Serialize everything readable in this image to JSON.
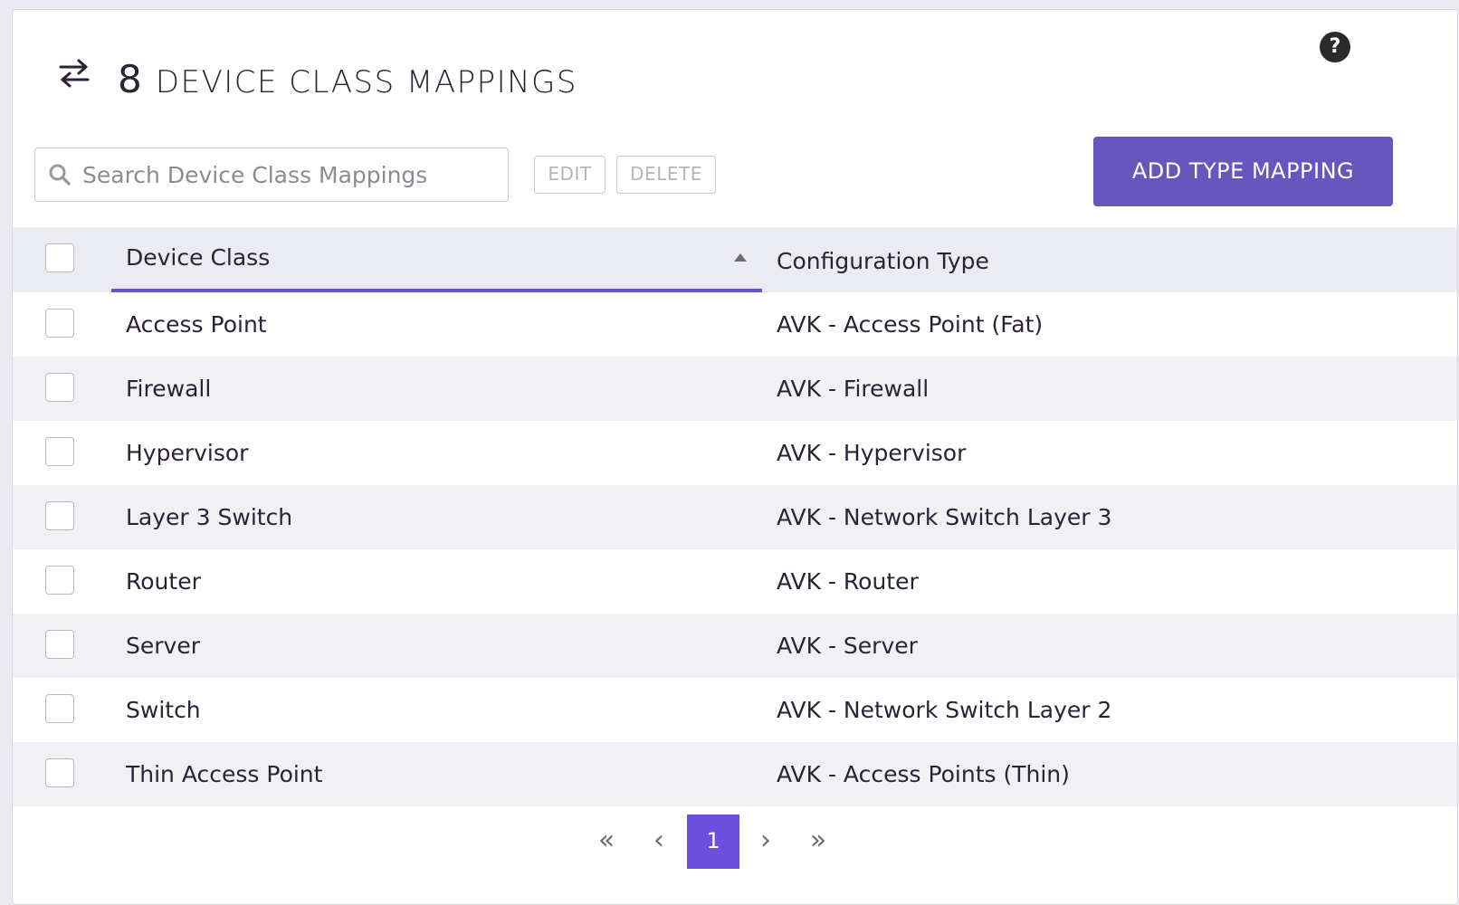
{
  "header": {
    "count": "8",
    "title": "DEVICE CLASS MAPPINGS",
    "title_icon": "swap-arrows-icon",
    "help_icon": "help-icon",
    "help_glyph": "?"
  },
  "toolbar": {
    "search_placeholder": "Search Device Class Mappings",
    "search_value": "",
    "edit_label": "EDIT",
    "delete_label": "DELETE",
    "add_label": "ADD TYPE MAPPING"
  },
  "table": {
    "columns": [
      "Device Class",
      "Configuration Type"
    ],
    "sort_column": "Device Class",
    "sort_direction": "ascending",
    "rows": [
      {
        "device_class": "Access Point",
        "configuration_type": "AVK - Access Point (Fat)"
      },
      {
        "device_class": "Firewall",
        "configuration_type": "AVK - Firewall"
      },
      {
        "device_class": "Hypervisor",
        "configuration_type": "AVK - Hypervisor"
      },
      {
        "device_class": "Layer 3 Switch",
        "configuration_type": "AVK - Network Switch Layer 3"
      },
      {
        "device_class": "Router",
        "configuration_type": "AVK - Router"
      },
      {
        "device_class": "Server",
        "configuration_type": "AVK - Server"
      },
      {
        "device_class": "Switch",
        "configuration_type": "AVK - Network Switch Layer 2"
      },
      {
        "device_class": "Thin Access Point",
        "configuration_type": "AVK - Access Points (Thin)"
      }
    ]
  },
  "pagination": {
    "first_glyph": "«",
    "prev_glyph": "‹",
    "current_page": "1",
    "next_glyph": "›",
    "last_glyph": "»"
  },
  "colors": {
    "accent": "#6756bd",
    "sort_underline": "#6a50dc",
    "header_bg": "#ebebf2",
    "alt_row_bg": "#f1f1f5"
  }
}
